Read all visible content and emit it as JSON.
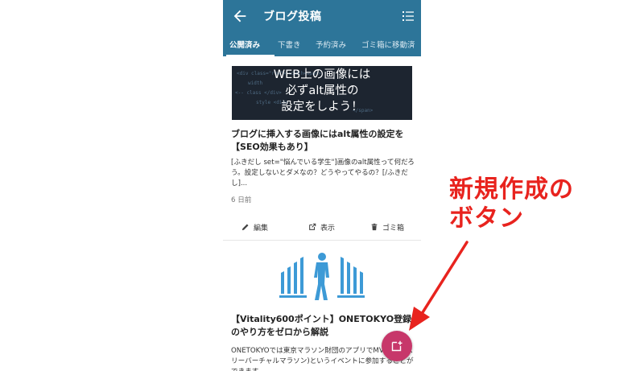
{
  "appbar": {
    "title": "ブログ投稿",
    "back_icon": "arrow-left-icon",
    "menu_icon": "list-icon"
  },
  "tabs": [
    {
      "label": "公開済み",
      "active": true
    },
    {
      "label": "下書き",
      "active": false
    },
    {
      "label": "予約済み",
      "active": false
    },
    {
      "label": "ゴミ箱に移動済",
      "active": false
    }
  ],
  "posts": [
    {
      "image_lines": [
        "WEB上の画像には",
        "必ずalt属性の",
        "設定をしよう！"
      ],
      "title": "ブログに挿入する画像にはalt属性の設定を【SEO効果もあり】",
      "excerpt": "[ふきだし set=\"悩んでいる学生\"]画像のalt属性って何だろう。設定しないとダメなの？どうやってやるの？[/ふきだし]...",
      "time": "6 日前",
      "actions": {
        "edit": "編集",
        "view": "表示",
        "trash": "ゴミ箱"
      }
    },
    {
      "title": "【Vitality600ポイント】ONETOKYO登録のやり方をゼロから解説",
      "excerpt": "ONETOKYOでは東京マラソン財団のアプリでMVM(マンスリーバーチャルマラソン)というイベントに参加することができます。"
    }
  ],
  "fab": {
    "icon": "add-post-icon",
    "color": "#c7376a"
  },
  "annotation": {
    "line1": "新規作成の",
    "line2": "ボタン",
    "color": "#e8231e"
  },
  "colors": {
    "primary": "#2d7599",
    "accent": "#c7376a"
  }
}
